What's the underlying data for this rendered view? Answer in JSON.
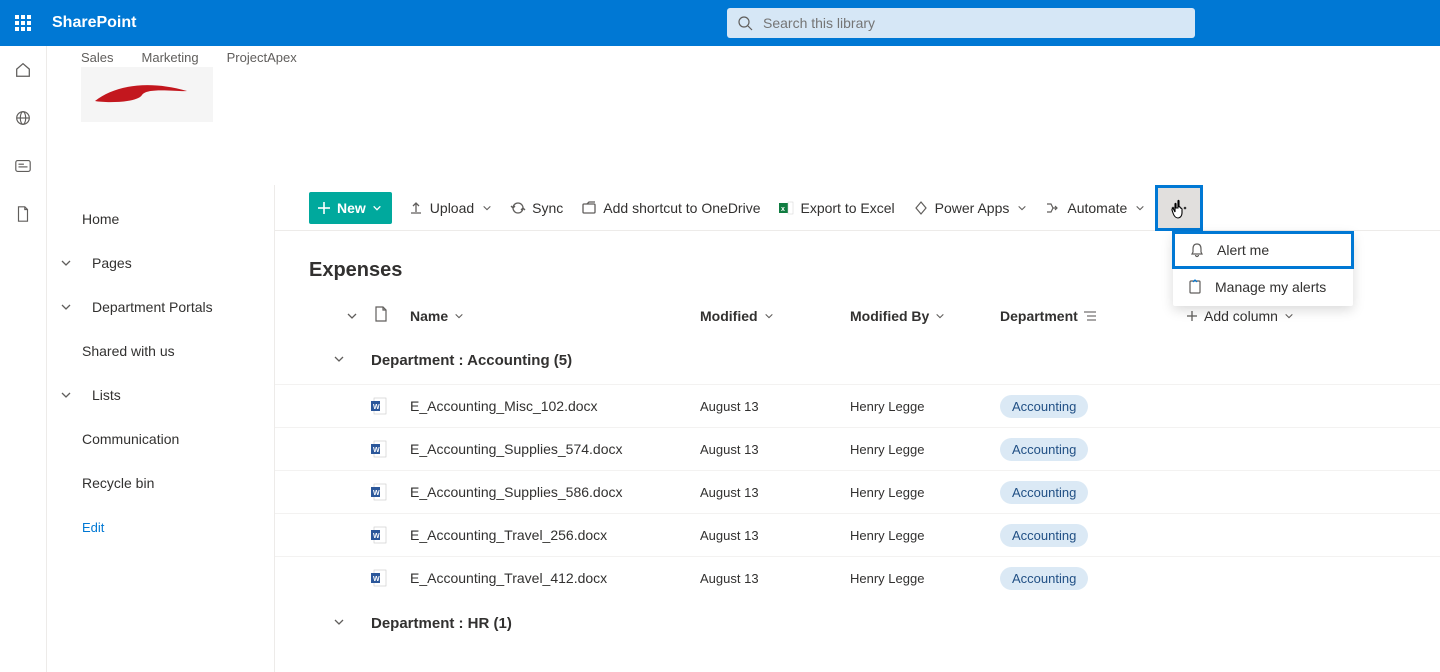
{
  "app": {
    "brand": "SharePoint"
  },
  "search": {
    "placeholder": "Search this library"
  },
  "hub": {
    "links": [
      "Sales",
      "Marketing",
      "ProjectApex"
    ]
  },
  "sidenav": {
    "home": "Home",
    "pages": "Pages",
    "portals": "Department Portals",
    "shared": "Shared with us",
    "lists": "Lists",
    "communication": "Communication",
    "recycle": "Recycle bin",
    "edit": "Edit"
  },
  "toolbar": {
    "new": "New",
    "upload": "Upload",
    "sync": "Sync",
    "shortcut": "Add shortcut to OneDrive",
    "export": "Export to Excel",
    "powerapps": "Power Apps",
    "automate": "Automate"
  },
  "dropdown": {
    "alert": "Alert me",
    "manage": "Manage my alerts"
  },
  "library": {
    "title": "Expenses",
    "columns": {
      "name": "Name",
      "modified": "Modified",
      "modifiedBy": "Modified By",
      "department": "Department",
      "add": "Add column"
    },
    "groups": [
      {
        "label": "Department : Accounting (5)",
        "rows": [
          {
            "name": "E_Accounting_Misc_102.docx",
            "modified": "August 13",
            "by": "Henry Legge",
            "dept": "Accounting"
          },
          {
            "name": "E_Accounting_Supplies_574.docx",
            "modified": "August 13",
            "by": "Henry Legge",
            "dept": "Accounting"
          },
          {
            "name": "E_Accounting_Supplies_586.docx",
            "modified": "August 13",
            "by": "Henry Legge",
            "dept": "Accounting"
          },
          {
            "name": "E_Accounting_Travel_256.docx",
            "modified": "August 13",
            "by": "Henry Legge",
            "dept": "Accounting"
          },
          {
            "name": "E_Accounting_Travel_412.docx",
            "modified": "August 13",
            "by": "Henry Legge",
            "dept": "Accounting"
          }
        ]
      },
      {
        "label": "Department : HR (1)",
        "rows": []
      }
    ]
  }
}
